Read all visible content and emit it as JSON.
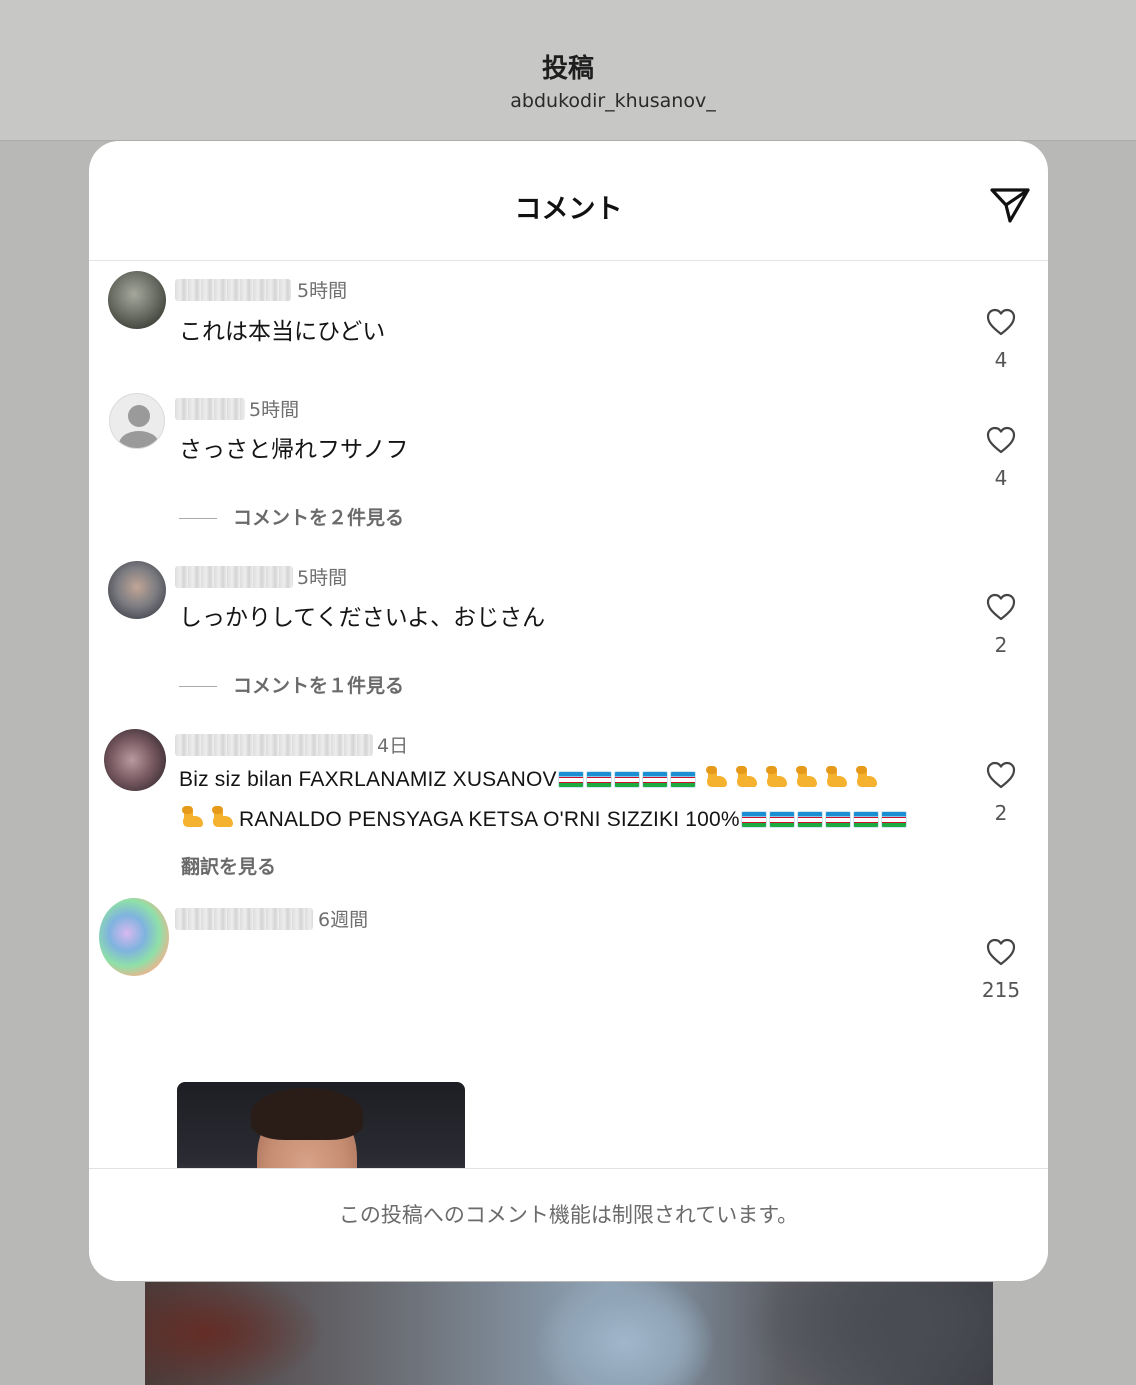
{
  "background": {
    "title": "投稿",
    "username": "abdukodir_khusanov_"
  },
  "modal": {
    "title": "コメント",
    "send_icon": "send-icon",
    "footer_text": "この投稿へのコメント機能は制限されています。"
  },
  "comments": [
    {
      "time": "5時間",
      "text": "これは本当にひどい",
      "likes": "4"
    },
    {
      "time": "5時間",
      "text": "さっさと帰れフサノフ",
      "likes": "4",
      "view_replies": "コメントを２件見る"
    },
    {
      "time": "5時間",
      "text": "しっかりしてくださいよ、おじさん",
      "likes": "2",
      "view_replies": "コメントを１件見る"
    },
    {
      "time": "4日",
      "text_line1": "Biz siz bilan FAXRLANAMIZ XUSANOV",
      "text_line2": "RANALDO PENSYAGA KETSA O'RNI SIZZIKI 100%",
      "likes": "2",
      "translate": "翻訳を見る",
      "emojis": [
        "uzbekistan-flag-emoji",
        "flexed-biceps-emoji"
      ]
    },
    {
      "time": "6週間",
      "likes": "215",
      "attachment": "photo"
    }
  ]
}
